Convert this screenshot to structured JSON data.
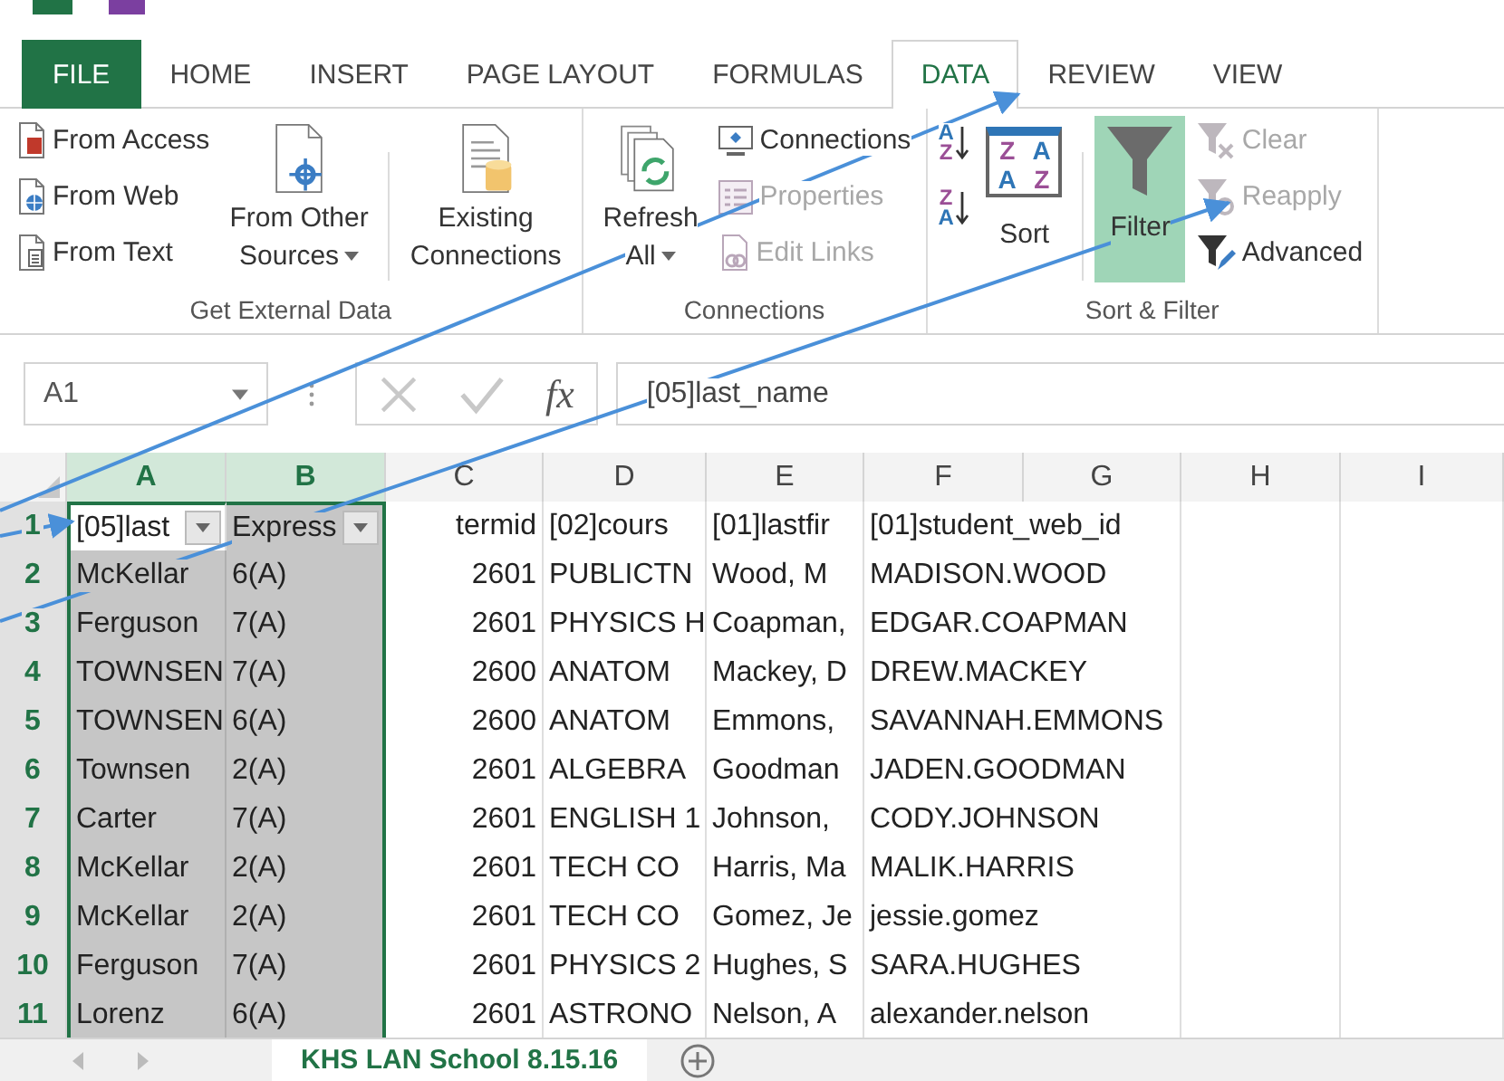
{
  "tabs": [
    {
      "label": "FILE",
      "kind": "file",
      "selected": false
    },
    {
      "label": "HOME",
      "kind": "tab",
      "selected": false
    },
    {
      "label": "INSERT",
      "kind": "tab",
      "selected": false
    },
    {
      "label": "PAGE LAYOUT",
      "kind": "tab",
      "selected": false
    },
    {
      "label": "FORMULAS",
      "kind": "tab",
      "selected": false
    },
    {
      "label": "DATA",
      "kind": "tab",
      "selected": true
    },
    {
      "label": "REVIEW",
      "kind": "tab",
      "selected": false
    },
    {
      "label": "VIEW",
      "kind": "tab",
      "selected": false
    }
  ],
  "ribbon": {
    "groups": [
      {
        "label": "Get External Data",
        "items": [
          {
            "kind": "stack",
            "buttons": [
              {
                "label": "From Access",
                "disabled": false
              },
              {
                "label": "From Web",
                "disabled": false
              },
              {
                "label": "From Text",
                "disabled": false
              }
            ]
          },
          {
            "kind": "large",
            "lines": [
              "From Other",
              "Sources"
            ],
            "dropdown": true,
            "selected": false
          },
          {
            "kind": "separator"
          },
          {
            "kind": "large",
            "lines": [
              "Existing",
              "Connections"
            ],
            "dropdown": false,
            "selected": false
          }
        ]
      },
      {
        "label": "Connections",
        "items": [
          {
            "kind": "large",
            "lines": [
              "Refresh",
              "All"
            ],
            "dropdown": true,
            "selected": false
          },
          {
            "kind": "stack",
            "buttons": [
              {
                "label": "Connections",
                "disabled": false
              },
              {
                "label": "Properties",
                "disabled": true
              },
              {
                "label": "Edit Links",
                "disabled": true
              }
            ]
          }
        ]
      },
      {
        "label": "Sort & Filter",
        "items": [
          {
            "kind": "sortpair",
            "buttons": [
              {
                "letters": [
                  "A",
                  "Z"
                ]
              },
              {
                "letters": [
                  "Z",
                  "A"
                ]
              }
            ]
          },
          {
            "kind": "large",
            "lines": [
              "Sort"
            ],
            "letters": [
              "Z",
              "A",
              "A",
              "Z"
            ],
            "dropdown": false,
            "selected": false
          },
          {
            "kind": "separator"
          },
          {
            "kind": "large",
            "lines": [
              "Filter"
            ],
            "dropdown": false,
            "selected": true
          },
          {
            "kind": "stack",
            "buttons": [
              {
                "label": "Clear",
                "disabled": true
              },
              {
                "label": "Reapply",
                "disabled": true
              },
              {
                "label": "Advanced",
                "disabled": false
              }
            ]
          }
        ]
      }
    ]
  },
  "formula_bar": {
    "name_box": "A1",
    "fx": "fx",
    "formula": "[05]last_name"
  },
  "sheet": {
    "columns": [
      {
        "letter": "A",
        "selected": true
      },
      {
        "letter": "B",
        "selected": true
      },
      {
        "letter": "C",
        "selected": false
      },
      {
        "letter": "D",
        "selected": false
      },
      {
        "letter": "E",
        "selected": false
      },
      {
        "letter": "F",
        "selected": false
      },
      {
        "letter": "G",
        "selected": false
      },
      {
        "letter": "H",
        "selected": false
      },
      {
        "letter": "I",
        "selected": false
      }
    ],
    "rows": [
      {
        "number": "1",
        "selected": true,
        "cells": [
          {
            "text": "[05]last",
            "filter": true,
            "active": true
          },
          {
            "text": "Express",
            "filter": true,
            "active": false
          },
          {
            "text": "termid",
            "filter": false,
            "active": false
          },
          {
            "text": "[02]cours",
            "filter": false,
            "active": false
          },
          {
            "text": "[01]lastfir",
            "filter": false,
            "active": false
          },
          {
            "text": "[01]student_web_id",
            "filter": false,
            "active": false
          }
        ]
      },
      {
        "number": "2",
        "selected": true,
        "cells": [
          {
            "text": "McKellar"
          },
          {
            "text": "6(A)"
          },
          {
            "text": "2601"
          },
          {
            "text": "PUBLICTN"
          },
          {
            "text": "Wood, M"
          },
          {
            "text": "MADISON.WOOD"
          }
        ]
      },
      {
        "number": "3",
        "selected": true,
        "cells": [
          {
            "text": "Ferguson"
          },
          {
            "text": "7(A)"
          },
          {
            "text": "2601"
          },
          {
            "text": "PHYSICS H"
          },
          {
            "text": "Coapman,"
          },
          {
            "text": "EDGAR.COAPMAN"
          }
        ]
      },
      {
        "number": "4",
        "selected": true,
        "cells": [
          {
            "text": "TOWNSEN"
          },
          {
            "text": "7(A)"
          },
          {
            "text": "2600"
          },
          {
            "text": "ANATOM"
          },
          {
            "text": "Mackey, D"
          },
          {
            "text": "DREW.MACKEY"
          }
        ]
      },
      {
        "number": "5",
        "selected": true,
        "cells": [
          {
            "text": "TOWNSEN"
          },
          {
            "text": "6(A)"
          },
          {
            "text": "2600"
          },
          {
            "text": "ANATOM"
          },
          {
            "text": "Emmons,"
          },
          {
            "text": "SAVANNAH.EMMONS"
          }
        ]
      },
      {
        "number": "6",
        "selected": true,
        "cells": [
          {
            "text": "Townsen"
          },
          {
            "text": "2(A)"
          },
          {
            "text": "2601"
          },
          {
            "text": "ALGEBRA"
          },
          {
            "text": "Goodman"
          },
          {
            "text": "JADEN.GOODMAN"
          }
        ]
      },
      {
        "number": "7",
        "selected": true,
        "cells": [
          {
            "text": "Carter"
          },
          {
            "text": "7(A)"
          },
          {
            "text": "2601"
          },
          {
            "text": "ENGLISH 1"
          },
          {
            "text": "Johnson,"
          },
          {
            "text": "CODY.JOHNSON"
          }
        ]
      },
      {
        "number": "8",
        "selected": true,
        "cells": [
          {
            "text": "McKellar"
          },
          {
            "text": "2(A)"
          },
          {
            "text": "2601"
          },
          {
            "text": "TECH CO"
          },
          {
            "text": "Harris, Ma"
          },
          {
            "text": "MALIK.HARRIS"
          }
        ]
      },
      {
        "number": "9",
        "selected": true,
        "cells": [
          {
            "text": "McKellar"
          },
          {
            "text": "2(A)"
          },
          {
            "text": "2601"
          },
          {
            "text": "TECH CO"
          },
          {
            "text": "Gomez, Je"
          },
          {
            "text": "jessie.gomez"
          }
        ]
      },
      {
        "number": "10",
        "selected": true,
        "cells": [
          {
            "text": "Ferguson"
          },
          {
            "text": "7(A)"
          },
          {
            "text": "2601"
          },
          {
            "text": "PHYSICS 2"
          },
          {
            "text": "Hughes, S"
          },
          {
            "text": "SARA.HUGHES"
          }
        ]
      },
      {
        "number": "11",
        "selected": true,
        "cells": [
          {
            "text": "Lorenz"
          },
          {
            "text": "6(A)"
          },
          {
            "text": "2601"
          },
          {
            "text": "ASTRONO"
          },
          {
            "text": "Nelson, A"
          },
          {
            "text": "alexander.nelson"
          }
        ]
      }
    ]
  },
  "sheet_tabs": [
    {
      "label": "KHS LAN School 8.15.16",
      "selected": true
    }
  ]
}
